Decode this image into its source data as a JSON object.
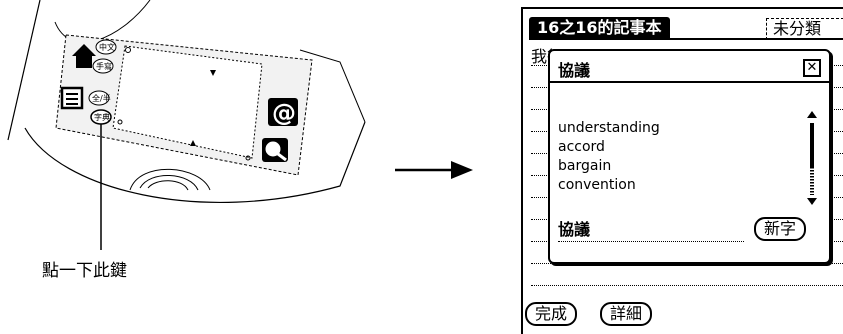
{
  "illustration": {
    "keys": {
      "chinese": "中文",
      "handwriting": "手寫",
      "full_half": "全/半",
      "dictionary": "字典"
    },
    "callout_label": "點一下此鍵"
  },
  "screen": {
    "title": "16之16的記事本",
    "category": "未分類",
    "memo_text": "我很",
    "dialog": {
      "title": "協議",
      "close_symbol": "✕",
      "results": [
        "understanding",
        "accord",
        "bargain",
        "convention"
      ],
      "lookup_word": "協議",
      "new_word_label": "新字"
    },
    "buttons": {
      "done": "完成",
      "details": "詳細"
    }
  }
}
